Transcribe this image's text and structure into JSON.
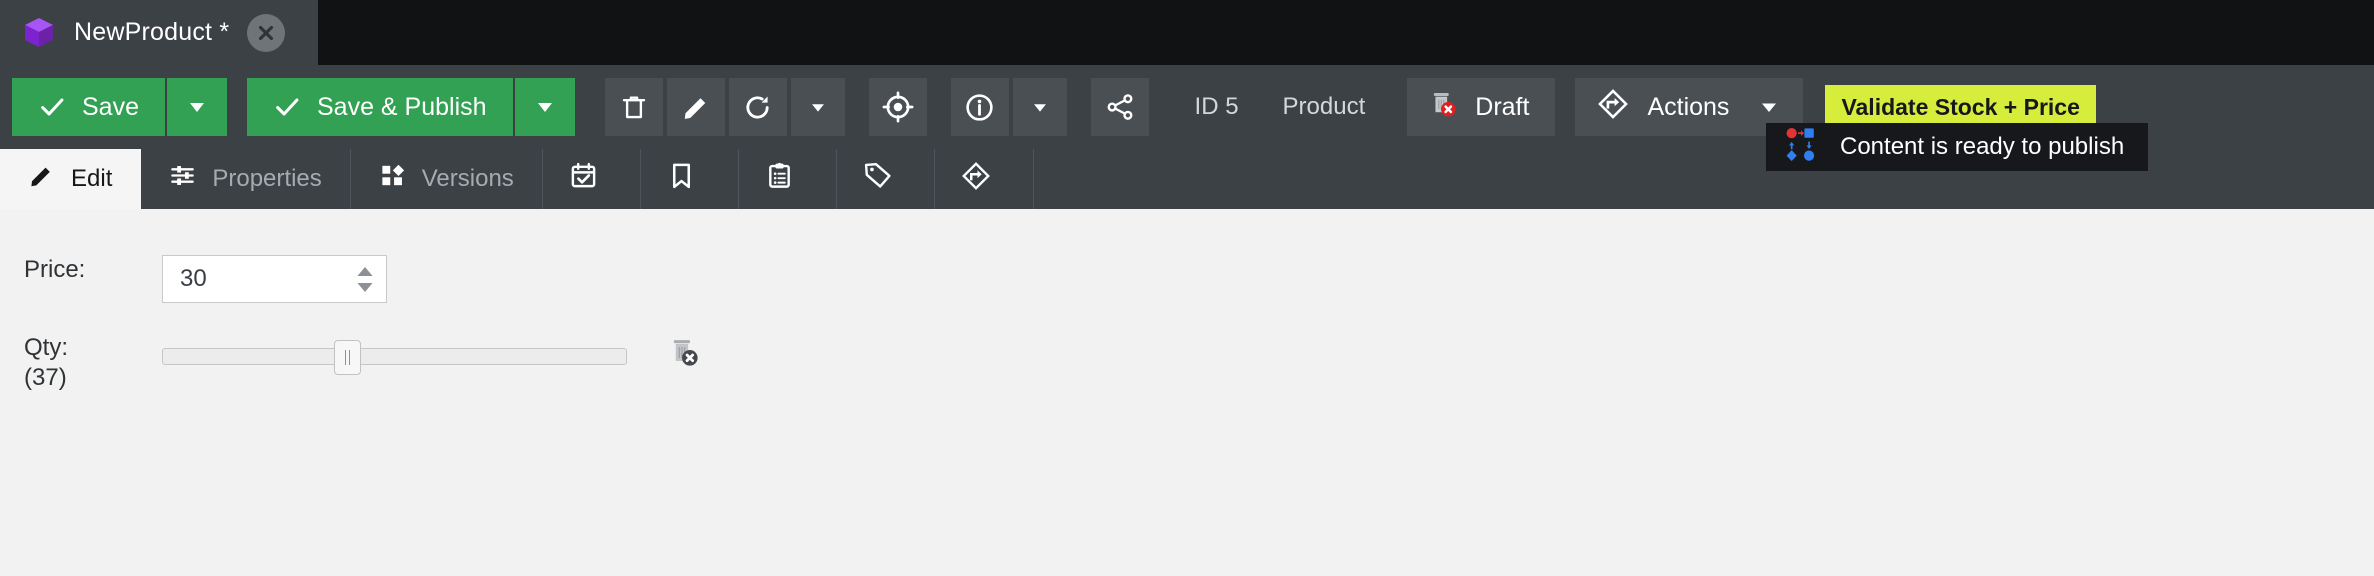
{
  "tab": {
    "title": "NewProduct *",
    "icon": "cube-icon",
    "close_icon": "close-icon"
  },
  "toolbar": {
    "save_label": "Save",
    "save_publish_label": "Save & Publish",
    "save_dropdown_icon": "chevron-down-icon",
    "save_publish_dropdown_icon": "chevron-down-icon",
    "delete_icon": "trash-icon",
    "edit_icon": "pencil-icon",
    "reload_icon": "refresh-icon",
    "reload_dropdown_icon": "chevron-down-icon",
    "target_icon": "target-icon",
    "info_icon": "info-icon",
    "info_dropdown_icon": "chevron-down-icon",
    "share_icon": "share-icon",
    "id_label": "ID 5",
    "type_label": "Product",
    "status_label": "Draft",
    "status_icon": "trash-error-icon",
    "actions_label": "Actions",
    "actions_icon": "workflow-diamond-icon",
    "actions_dropdown_icon": "chevron-down-icon",
    "validate_label": "Validate Stock + Price"
  },
  "tooltip": {
    "text": "Content is ready to publish",
    "icon": "workflow-nodes-icon"
  },
  "tabstrip": {
    "items": [
      {
        "label": "Edit",
        "icon": "pencil-icon",
        "active": true
      },
      {
        "label": "Properties",
        "icon": "sliders-icon",
        "active": false
      },
      {
        "label": "Versions",
        "icon": "grid-diamond-icon",
        "active": false
      },
      {
        "label": "",
        "icon": "calendar-check-icon",
        "active": false
      },
      {
        "label": "",
        "icon": "bookmark-icon",
        "active": false
      },
      {
        "label": "",
        "icon": "clipboard-list-icon",
        "active": false
      },
      {
        "label": "",
        "icon": "tag-icon",
        "active": false
      },
      {
        "label": "",
        "icon": "workflow-diamond-icon",
        "active": false
      }
    ]
  },
  "form": {
    "price": {
      "label": "Price:",
      "value": "30",
      "spinner_up_icon": "caret-up-icon",
      "spinner_down_icon": "caret-down-icon"
    },
    "qty": {
      "label": "Qty:",
      "value_label": "(37)",
      "slider_percent": 37,
      "delete_icon": "trash-error-icon"
    }
  },
  "colors": {
    "toolbar_bg": "#3c4146",
    "tabbar_bg": "#101214",
    "green": "#32a153",
    "validate_bg": "#d7ed3c",
    "content_bg": "#f2f2f2"
  }
}
